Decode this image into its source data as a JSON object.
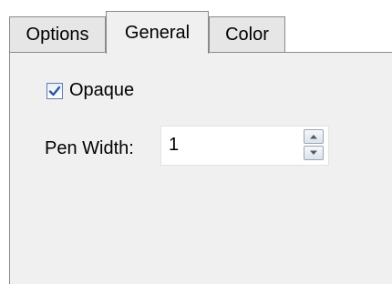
{
  "tabs": [
    {
      "label": "Options",
      "active": false
    },
    {
      "label": "General",
      "active": true
    },
    {
      "label": "Color",
      "active": false
    }
  ],
  "general": {
    "opaque": {
      "label": "Opaque",
      "checked": true
    },
    "pen_width": {
      "label": "Pen Width:",
      "value": "1"
    }
  },
  "colors": {
    "panel_bg": "#f0f0f0",
    "border": "#8a8a8a",
    "checkmark": "#2b56a6"
  },
  "icons": {
    "check": "checkmark-icon",
    "up": "spin-up-arrow-icon",
    "down": "spin-down-arrow-icon"
  }
}
